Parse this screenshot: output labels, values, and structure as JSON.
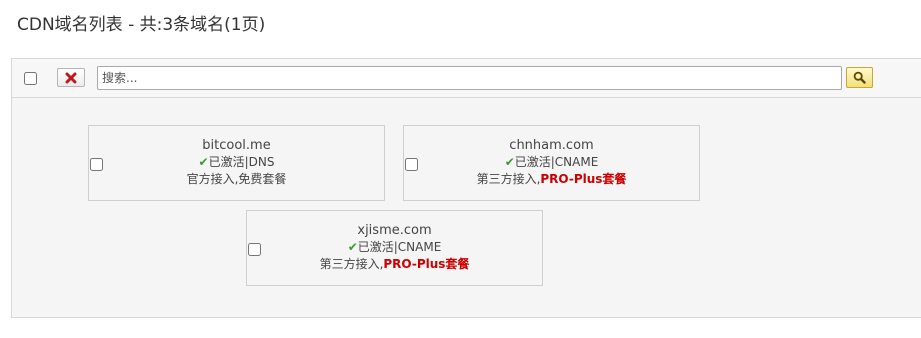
{
  "header": {
    "title": "CDN域名列表 - 共:3条域名(1页)"
  },
  "toolbar": {
    "search_placeholder": "搜索..."
  },
  "domains": [
    {
      "name": "bitcool.me",
      "status": "已激活|DNS",
      "access": "官方接入,",
      "plan": "免费套餐",
      "plan_highlight": false
    },
    {
      "name": "chnham.com",
      "status": "已激活|CNAME",
      "access": "第三方接入,",
      "plan": "PRO-Plus套餐",
      "plan_highlight": true
    },
    {
      "name": "xjisme.com",
      "status": "已激活|CNAME",
      "access": "第三方接入,",
      "plan": "PRO-Plus套餐",
      "plan_highlight": true
    }
  ],
  "icons": {
    "delete": "close-icon",
    "search": "search-icon",
    "status": "checkmark-icon"
  },
  "colors": {
    "active_check": "#3a9c2c",
    "pro_plan": "#cc0000"
  }
}
